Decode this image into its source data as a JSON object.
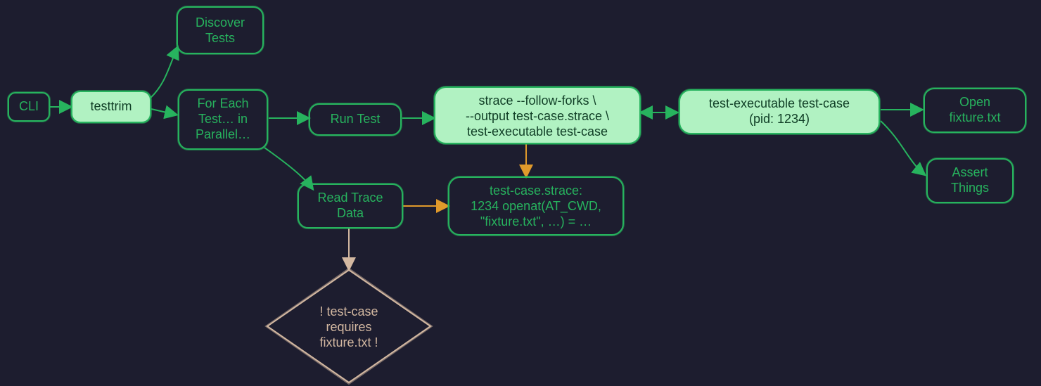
{
  "nodes": {
    "cli": {
      "label": "CLI"
    },
    "testtrim": {
      "label": "testtrim"
    },
    "discover": {
      "l1": "Discover",
      "l2": "Tests"
    },
    "foreach": {
      "l1": "For Each",
      "l2": "Test… in",
      "l3": "Parallel…"
    },
    "run": {
      "label": "Run Test"
    },
    "strace": {
      "l1": "strace --follow-forks \\",
      "l2": "--output test-case.strace \\",
      "l3": "test-executable test-case"
    },
    "exec": {
      "l1": "test-executable test-case",
      "l2": "(pid: 1234)"
    },
    "open": {
      "l1": "Open",
      "l2": "fixture.txt"
    },
    "assert": {
      "l1": "Assert",
      "l2": "Things"
    },
    "readtrace": {
      "l1": "Read Trace",
      "l2": "Data"
    },
    "tracefile": {
      "l1": "test-case.strace:",
      "l2": "1234 openat(AT_CWD,",
      "l3": "\"fixture.txt\", …) = …"
    },
    "requires": {
      "l1": "! test-case",
      "l2": "requires",
      "l3": "fixture.txt !"
    }
  },
  "colors": {
    "bg": "#1d1d2f",
    "green": "#27b35e",
    "greenFill": "#b1f2c2",
    "darkGreen": "#0f3d25",
    "orange": "#e09a2b",
    "tan": "#d3b8a1"
  }
}
